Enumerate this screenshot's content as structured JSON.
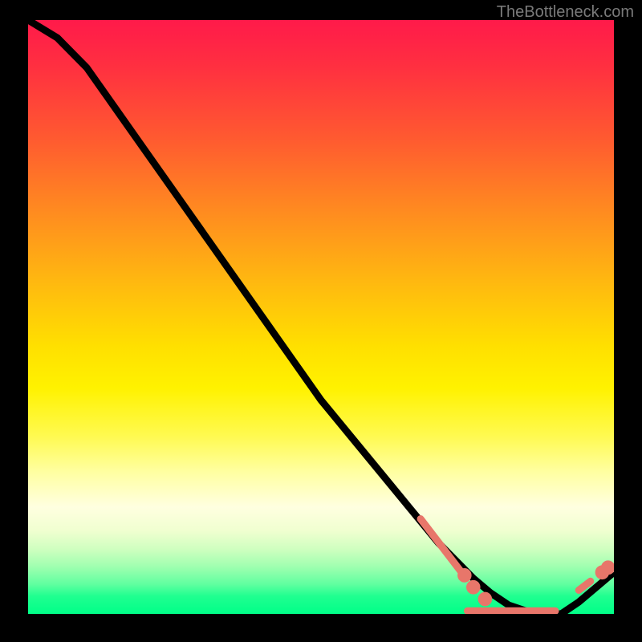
{
  "watermark": "TheBottleneck.com",
  "chart_data": {
    "type": "line",
    "title": "",
    "xlabel": "",
    "ylabel": "",
    "xlim": [
      0,
      100
    ],
    "ylim": [
      0,
      100
    ],
    "series": [
      {
        "name": "curve",
        "x": [
          0,
          5,
          10,
          15,
          20,
          25,
          30,
          35,
          40,
          45,
          50,
          55,
          60,
          65,
          70,
          73,
          76,
          79,
          82,
          85,
          88,
          91,
          94,
          97,
          100
        ],
        "values": [
          100,
          97,
          92,
          85,
          78,
          71,
          64,
          57,
          50,
          43,
          36,
          30,
          24,
          18,
          12,
          9,
          6,
          3.5,
          1.5,
          0.5,
          0,
          0,
          2,
          4.5,
          7
        ]
      }
    ],
    "highlight_segments": [
      {
        "x0": 67,
        "y0": 16,
        "x1": 74,
        "y1": 7
      },
      {
        "x0": 75,
        "y0": 0.5,
        "x1": 90,
        "y1": 0.5
      },
      {
        "x0": 94,
        "y0": 4,
        "x1": 96,
        "y1": 5.5
      }
    ],
    "highlight_dots": [
      {
        "x": 74.5,
        "y": 6.5
      },
      {
        "x": 76,
        "y": 4.5
      },
      {
        "x": 78,
        "y": 2.5
      },
      {
        "x": 98,
        "y": 7
      },
      {
        "x": 99,
        "y": 7.8
      }
    ]
  }
}
